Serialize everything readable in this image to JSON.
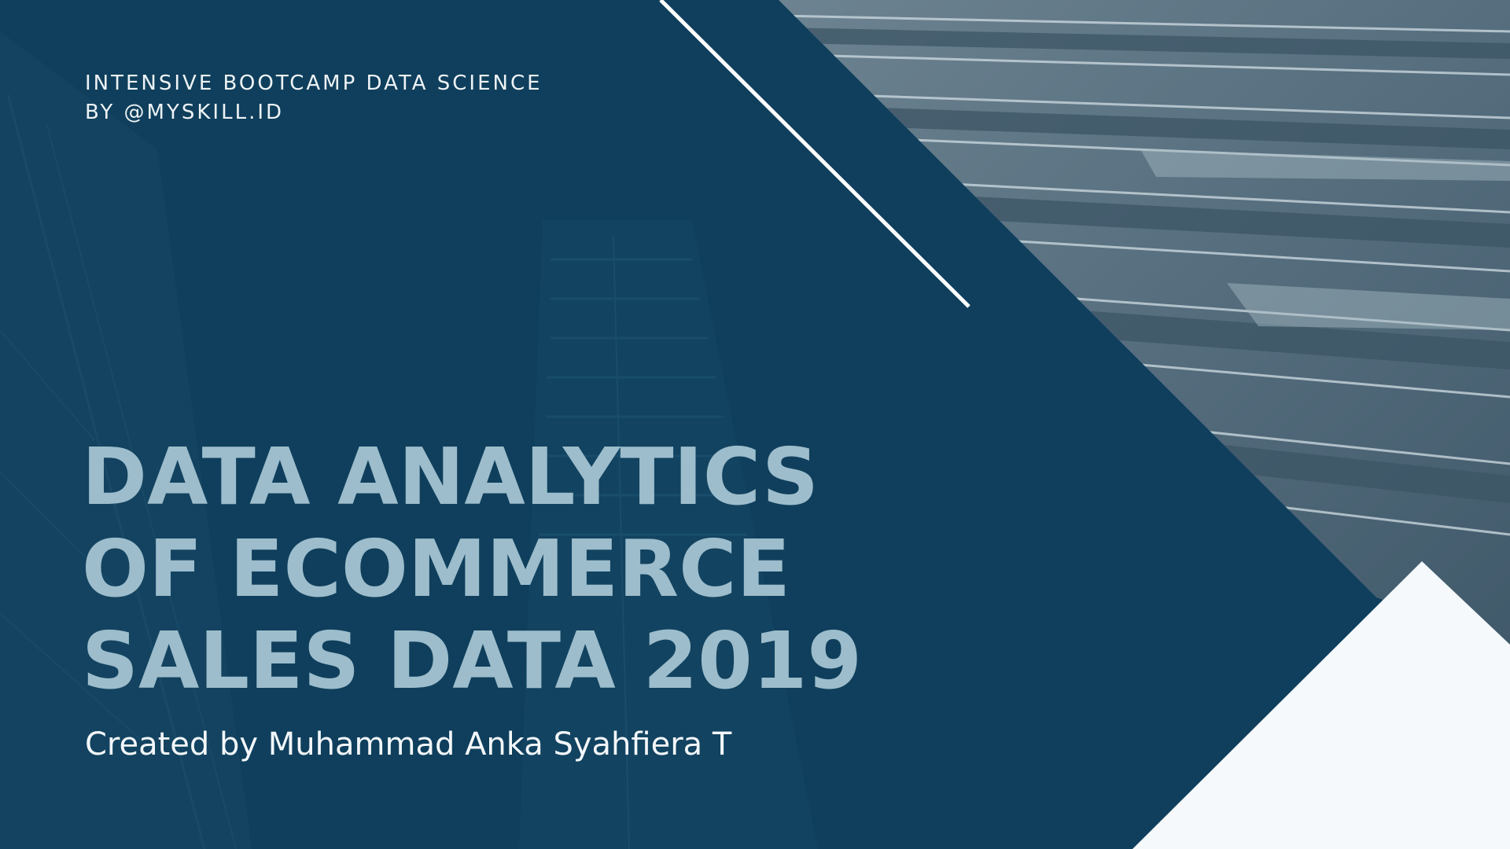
{
  "slide": {
    "subtitle_lines": [
      "INTENSIVE BOOTCAMP DATA SCIENCE",
      "BY @MYSKILL.ID"
    ],
    "title_lines": [
      "DATA ANALYTICS",
      "OF ECOMMERCE",
      "SALES DATA 2019"
    ],
    "author": "Created by Muhammad Anka Syahfiera T"
  },
  "colors": {
    "background_navy": "#0f3f5c",
    "title_text": "#9dbdcc",
    "body_text": "#f3f7fa",
    "photo_tint": "#5b7383",
    "corner_triangle": "#f5f9fc",
    "accent_line": "#ffffff"
  }
}
